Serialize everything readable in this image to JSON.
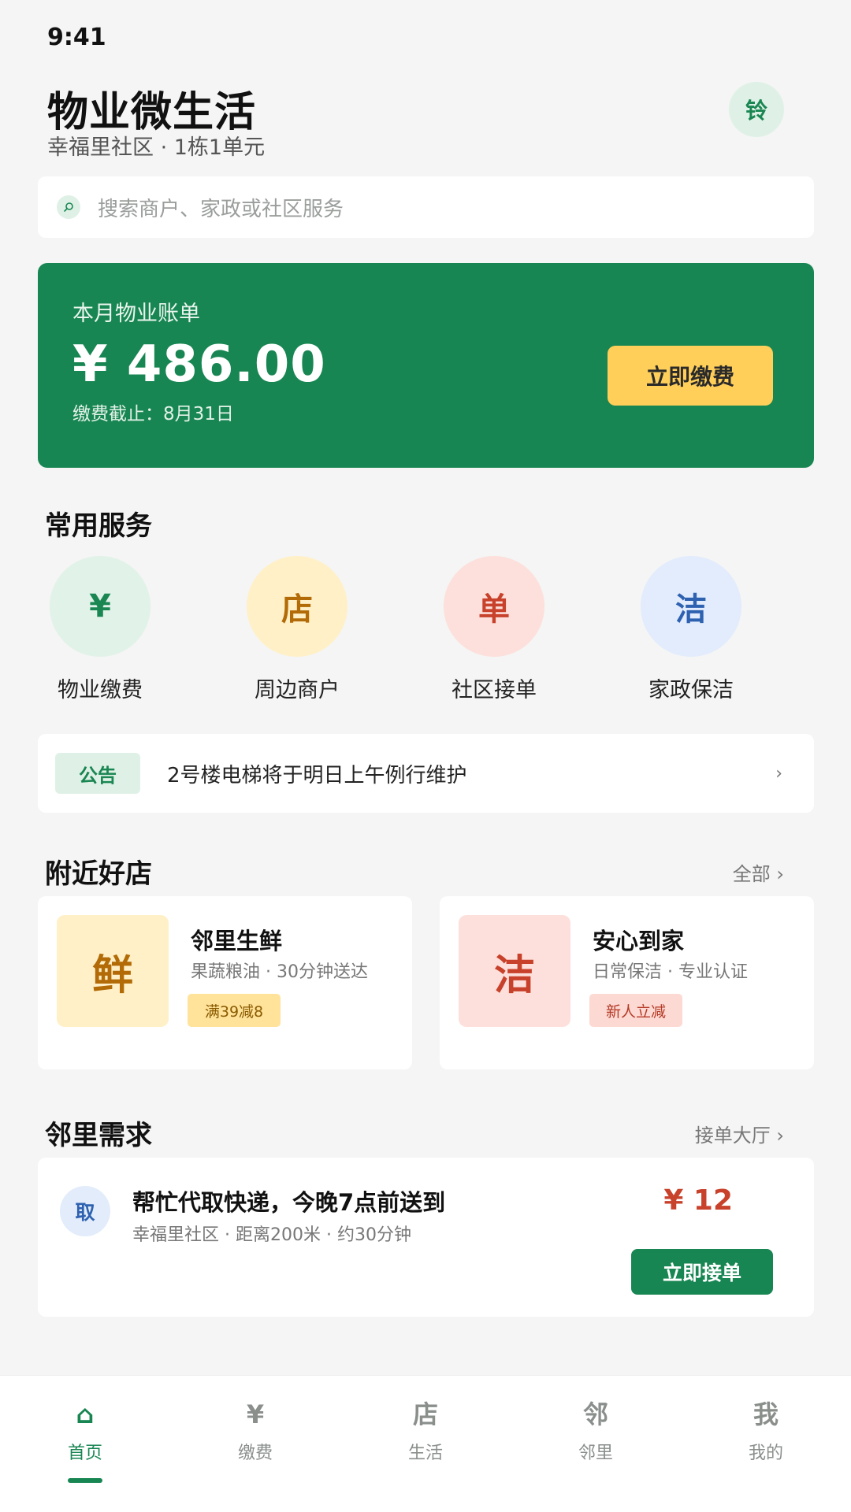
{
  "status_bar": {
    "time": "9:41"
  },
  "header": {
    "title": "物业微生活",
    "subtitle": "幸福里社区 · 1栋1单元",
    "bell_glyph": "铃"
  },
  "search": {
    "placeholder": "搜索商户、家政或社区服务",
    "icon": "search-icon"
  },
  "bill": {
    "label": "本月物业账单",
    "amount": "¥ 486.00",
    "due": "缴费截止：8月31日",
    "pay_label": "立即缴费"
  },
  "services": {
    "title": "常用服务",
    "items": [
      {
        "glyph": "¥",
        "label": "物业缴费",
        "bg": "#E1F2E8",
        "color": "#1A8652"
      },
      {
        "glyph": "店",
        "label": "周边商户",
        "bg": "#FFF0C7",
        "color": "#B26B06"
      },
      {
        "glyph": "单",
        "label": "社区接单",
        "bg": "#FDE0DB",
        "color": "#C8412B"
      },
      {
        "glyph": "洁",
        "label": "家政保洁",
        "bg": "#E2ECFD",
        "color": "#2E62B0"
      }
    ]
  },
  "notice": {
    "badge": "公告",
    "text": "2号楼电梯将于明日上午例行维护",
    "arrow": "›"
  },
  "nearby": {
    "title": "附近好店",
    "link": "全部 ›",
    "shops": [
      {
        "glyph": "鲜",
        "name": "邻里生鲜",
        "desc": "果蔬粮油 · 30分钟送达",
        "tag": "满39减8",
        "thumb_bg": "#FFF0C7",
        "thumb_color": "#B26B06",
        "tag_bg": "#FFE39A",
        "tag_color": "#8A5A00"
      },
      {
        "glyph": "洁",
        "name": "安心到家",
        "desc": "日常保洁 · 专业认证",
        "tag": "新人立减",
        "thumb_bg": "#FDE0DB",
        "thumb_color": "#C8412B",
        "tag_bg": "#FDD9D3",
        "tag_color": "#B43A26"
      }
    ]
  },
  "requests": {
    "title": "邻里需求",
    "link": "接单大厅 ›",
    "task": {
      "avatar": "取",
      "title": "帮忙代取快递，今晚7点前送到",
      "meta": "幸福里社区 · 距离200米 · 约30分钟",
      "price": "¥ 12",
      "accept_label": "立即接单"
    }
  },
  "tabbar": {
    "items": [
      {
        "glyph": "⌂",
        "label": "首页",
        "active": true
      },
      {
        "glyph": "¥",
        "label": "缴费",
        "active": false
      },
      {
        "glyph": "店",
        "label": "生活",
        "active": false
      },
      {
        "glyph": "邻",
        "label": "邻里",
        "active": false
      },
      {
        "glyph": "我",
        "label": "我的",
        "active": false
      }
    ]
  },
  "colors": {
    "brand": "#188652",
    "accent": "#FFCF5A",
    "price": "#C8412B"
  }
}
